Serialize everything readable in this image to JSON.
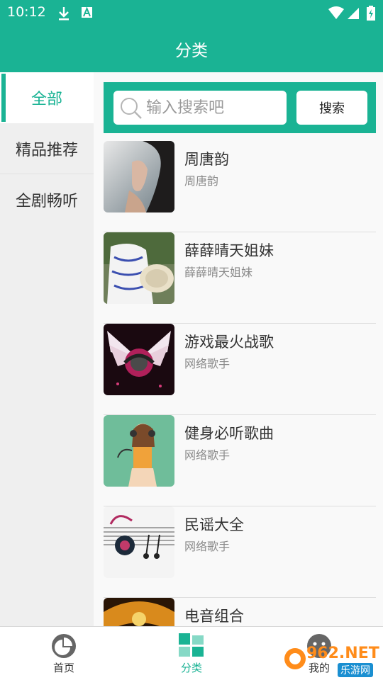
{
  "status_bar": {
    "time": "10:12",
    "icons": [
      "download-icon",
      "a-badge-icon",
      "wifi-icon",
      "signal-icon",
      "battery-icon"
    ]
  },
  "header": {
    "title": "分类"
  },
  "sidebar": {
    "items": [
      {
        "label": "全部",
        "active": true
      },
      {
        "label": "精品推荐",
        "active": false
      },
      {
        "label": "全剧畅听",
        "active": false
      }
    ]
  },
  "search": {
    "placeholder": "输入搜索吧",
    "value": "",
    "button_label": "搜索"
  },
  "artists": [
    {
      "name": "周唐韵",
      "singer": "周唐韵"
    },
    {
      "name": "薛薛晴天姐妹",
      "singer": "薛薛晴天姐妹"
    },
    {
      "name": "游戏最火战歌",
      "singer": "网络歌手"
    },
    {
      "name": "健身必听歌曲",
      "singer": "网络歌手"
    },
    {
      "name": "民谣大全",
      "singer": "网络歌手"
    },
    {
      "name": "电音组合",
      "singer": ""
    }
  ],
  "bottom_nav": {
    "items": [
      {
        "label": "首页",
        "icon": "pie-chart-icon",
        "active": false
      },
      {
        "label": "分类",
        "icon": "grid-icon",
        "active": true
      },
      {
        "label": "我的",
        "icon": "user-icon",
        "active": false
      }
    ]
  },
  "watermark": {
    "text": "962.NET",
    "sub": "乐游网"
  },
  "colors": {
    "accent": "#1ab394",
    "sidebar_bg": "#efefef",
    "text": "#333333",
    "subtext": "#8a8a8a"
  }
}
